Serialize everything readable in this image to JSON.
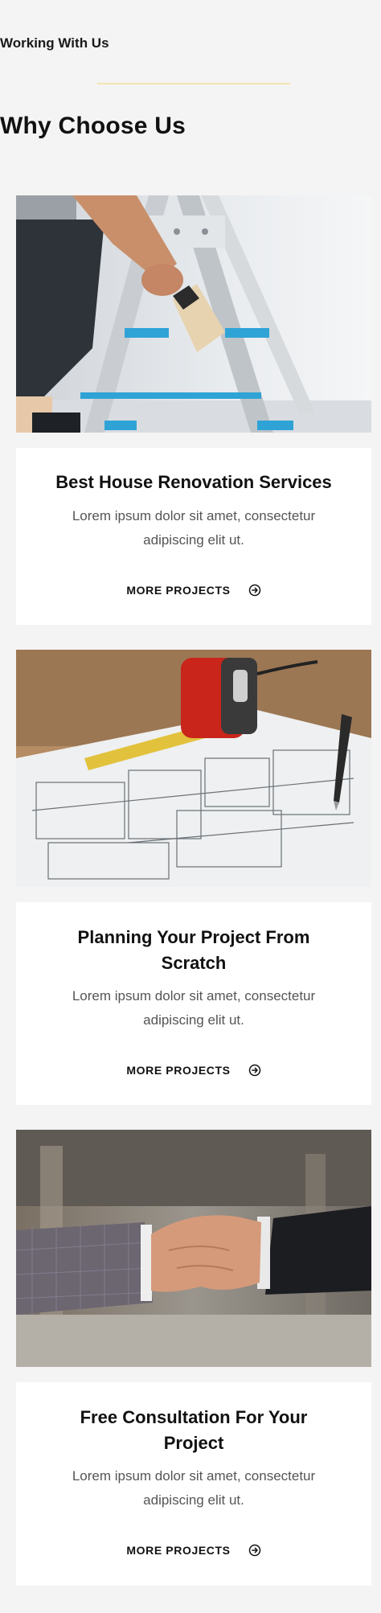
{
  "header": {
    "eyebrow": "Working With Us",
    "title": "Why Choose Us",
    "accent_color": "#f2e3b3"
  },
  "cards": [
    {
      "image": "painter-on-ladder-photo",
      "title_line1": "Best House Renovation Services",
      "title_line2": "",
      "text_line1": "Lorem ipsum dolor sit amet, consectetur",
      "text_line2": "adipiscing elit ut.",
      "link_label": "MORE PROJECTS",
      "link_icon": "arrow-circle-right-icon"
    },
    {
      "image": "blueprint-tape-measure-photo",
      "title_line1": "Planning Your Project From",
      "title_line2": "Scratch",
      "text_line1": "Lorem ipsum dolor sit amet, consectetur",
      "text_line2": "adipiscing elit ut.",
      "link_label": "MORE PROJECTS",
      "link_icon": "arrow-circle-right-icon"
    },
    {
      "image": "handshake-photo",
      "title_line1": "Free Consultation For Your",
      "title_line2": "Project",
      "text_line1": "Lorem ipsum dolor sit amet, consectetur",
      "text_line2": "adipiscing elit ut.",
      "link_label": "MORE PROJECTS",
      "link_icon": "arrow-circle-right-icon"
    }
  ]
}
